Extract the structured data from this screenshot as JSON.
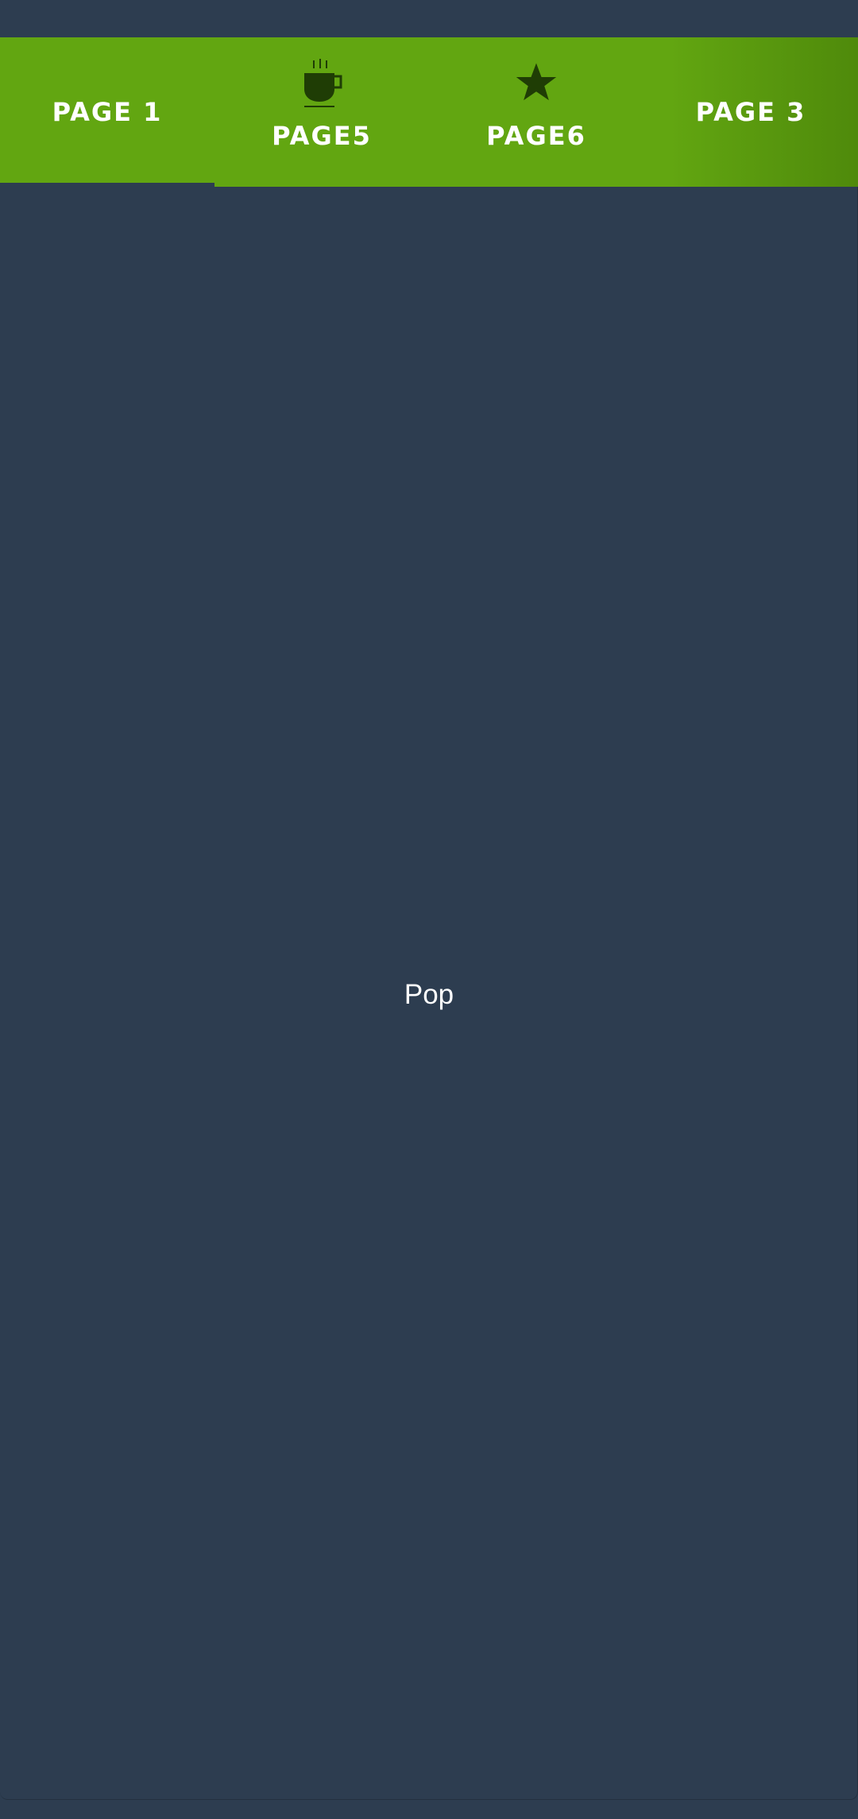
{
  "colors": {
    "background": "#2d3d50",
    "tab_bar": "#62a611",
    "icon": "#1f3d05",
    "text": "#ffffff"
  },
  "tabs": [
    {
      "label": "PAGE 1",
      "icon": null,
      "selected": true
    },
    {
      "label": "PAGE5",
      "icon": "coffee-cup-icon",
      "selected": false
    },
    {
      "label": "PAGE6",
      "icon": "star-icon",
      "selected": false
    },
    {
      "label": "PAGE 3",
      "icon": null,
      "selected": false
    }
  ],
  "content": {
    "text": "Pop"
  }
}
